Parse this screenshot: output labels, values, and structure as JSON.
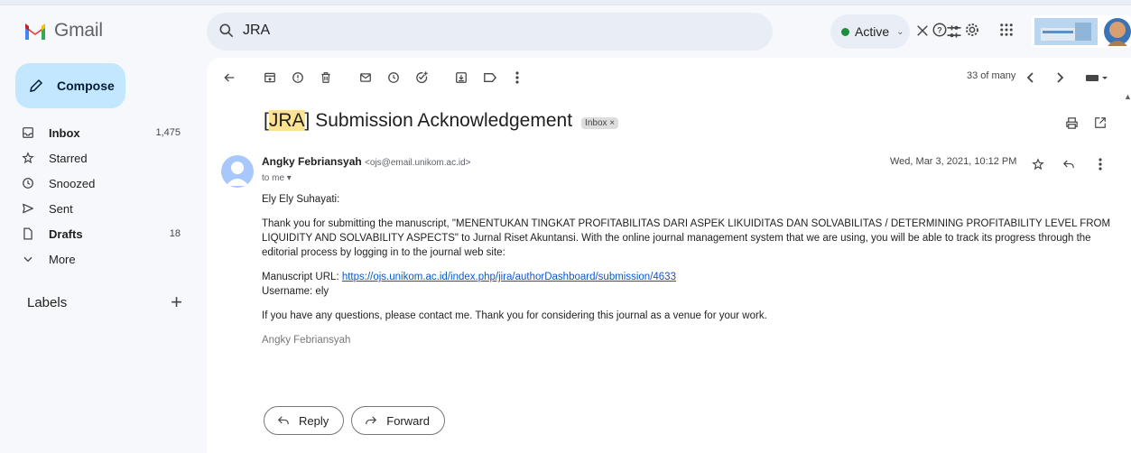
{
  "app": {
    "name": "Gmail"
  },
  "search": {
    "query": "JRA"
  },
  "status": {
    "label": "Active"
  },
  "colors": {
    "accent": "#c2e7ff",
    "highlight": "#fde293",
    "link": "#1155cc",
    "active_dot": "#1e8e3e"
  },
  "sidebar": {
    "compose_label": "Compose",
    "items": [
      {
        "label": "Inbox",
        "count": "1,475",
        "icon": "inbox-icon",
        "bold": true
      },
      {
        "label": "Starred",
        "count": "",
        "icon": "star-icon",
        "bold": false
      },
      {
        "label": "Snoozed",
        "count": "",
        "icon": "clock-icon",
        "bold": false
      },
      {
        "label": "Sent",
        "count": "",
        "icon": "send-icon",
        "bold": false
      },
      {
        "label": "Drafts",
        "count": "18",
        "icon": "draft-icon",
        "bold": true
      },
      {
        "label": "More",
        "count": "",
        "icon": "chevron-down-icon",
        "bold": false
      }
    ],
    "labels_header": "Labels"
  },
  "toolbar": {
    "pager": "33 of many"
  },
  "email": {
    "subject_highlight": "JRA",
    "subject_rest": " Submission Acknowledgement",
    "tag": "Inbox ×",
    "sender_name": "Angky Febriansyah",
    "sender_addr": "<ojs@email.unikom.ac.id>",
    "to": "to me ▾",
    "date": "Wed, Mar 3, 2021, 10:12 PM",
    "greeting": "Ely Ely Suhayati:",
    "paragraph1": "Thank you for submitting the manuscript, \"MENENTUKAN TINGKAT PROFITABILITAS DARI ASPEK LIKUIDITAS DAN SOLVABILITAS / DETERMINING PROFITABILITY LEVEL FROM LIQUIDITY AND SOLVABILITY ASPECTS\" to Jurnal Riset Akuntansi. With the online journal management system that we are using, you will be able to track its progress through the editorial process by logging in to the journal web site:",
    "url_label": "Manuscript URL: ",
    "url": "https://ojs.unikom.ac.id/index.php/jira/authorDashboard/submission/4633",
    "username": "Username: ely",
    "paragraph3": "If you have any questions, please contact me. Thank you for considering this journal as a venue for your work.",
    "signature": "Angky Febriansyah"
  },
  "actions": {
    "reply": "Reply",
    "forward": "Forward"
  }
}
